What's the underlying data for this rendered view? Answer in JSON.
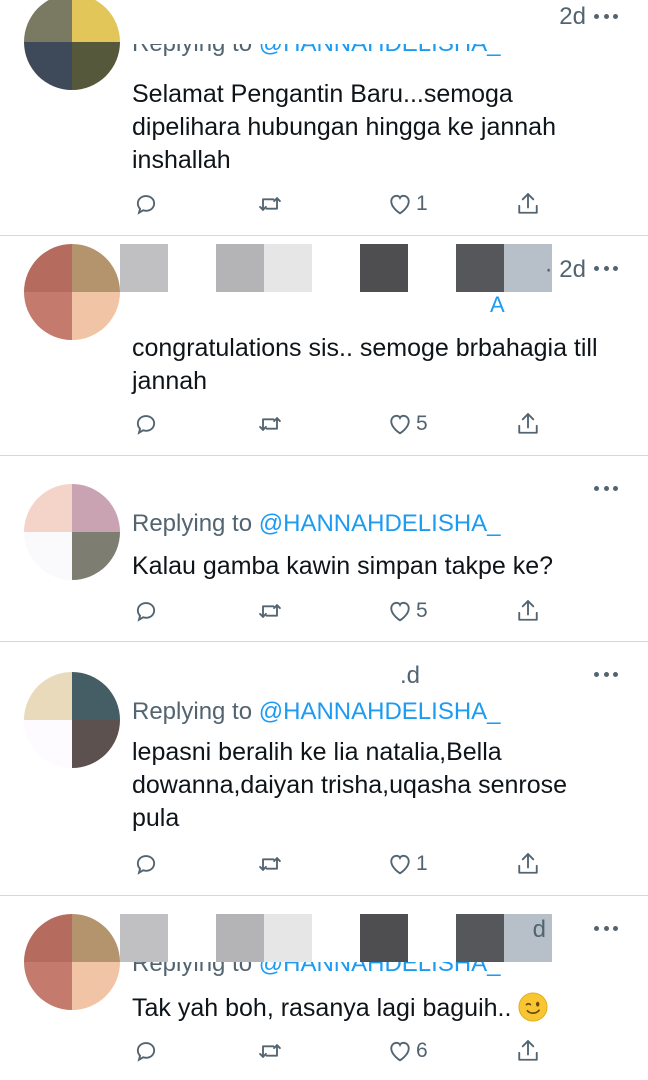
{
  "tweets": [
    {
      "time": "2d",
      "reply_prefix": "Replying to",
      "reply_handle": "@HANNAHDELISHA_",
      "text": "Selamat Pengantin Baru...semoga dipelihara hubungan hingga ke jannah inshallah",
      "likes": "1",
      "avatar_colors": [
        "#7a7a62",
        "#e3c65a",
        "#3e4a5a",
        "#55583a"
      ]
    },
    {
      "time": "· 2d",
      "reply_text_fragment": "A_",
      "text": "congratulations sis.. semoge brbahagia till jannah",
      "likes": "5",
      "avatar_colors": [
        "#4d4f4c",
        "#c98c72",
        "#2a2820",
        "#6a6348"
      ],
      "header_blocks": [
        "#0c0d10",
        "#2c2e33",
        "#4f5256",
        "#ffffff",
        "#ffffff",
        "#65707e",
        "#fdfbf8",
        "#515c69",
        "#8997a7"
      ]
    },
    {
      "time": "",
      "reply_prefix": "Replying to",
      "reply_handle": "@HANNAHDELISHA_",
      "text": "Kalau gamba kawin simpan takpe ke?",
      "likes": "5",
      "avatar_colors": [
        "#f4d3c8",
        "#c9a3b2",
        "#fafafc",
        "#7d7d72"
      ]
    },
    {
      "time": ".d",
      "reply_prefix": "Replying to",
      "reply_handle": "@HANNAHDELISHA_",
      "text": "lepasni beralih ke lia natalia,Bella dowanna,daiyan trisha,uqasha senrose pula",
      "likes": "1",
      "avatar_colors": [
        "#e8dabb",
        "#455d65",
        "#fdfbff",
        "#5d5150"
      ]
    },
    {
      "time": "d",
      "reply_prefix": "Replying to",
      "reply_handle": "@HANNAHDELISHA_",
      "text": "Tak yah boh, rasanya lagi baguih..",
      "likes": "6",
      "avatar_colors": [
        "#b56b5e",
        "#b4946c",
        "#c47a6c",
        "#f0c4a4"
      ],
      "header_blocks": [
        "#c0c0c2",
        "#ffffff",
        "#b4b4b6",
        "#e6e6e6",
        "#ffffff",
        "#4e4e50",
        "#ffffff",
        "#56575b",
        "#b7c0c8"
      ]
    }
  ]
}
